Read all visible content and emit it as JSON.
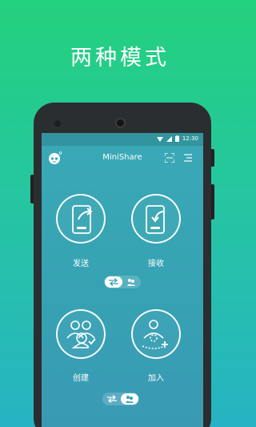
{
  "promo": {
    "title": "两种模式"
  },
  "status_bar": {
    "time": "12:30"
  },
  "app": {
    "title": "MiniShare"
  },
  "actions": {
    "send": {
      "label": "发送"
    },
    "receive": {
      "label": "接收"
    },
    "create": {
      "label": "创建"
    },
    "join": {
      "label": "加入"
    }
  },
  "toggles": {
    "top": {
      "selected": "swap-icon",
      "other": "group-icon"
    },
    "bottom": {
      "selected": "group-icon",
      "other": "swap-icon"
    }
  },
  "colors": {
    "bg_top": "#24d17c",
    "bg_bottom": "#27b3c4",
    "screen": "#36a2b3",
    "phone": "#2b2e30"
  }
}
